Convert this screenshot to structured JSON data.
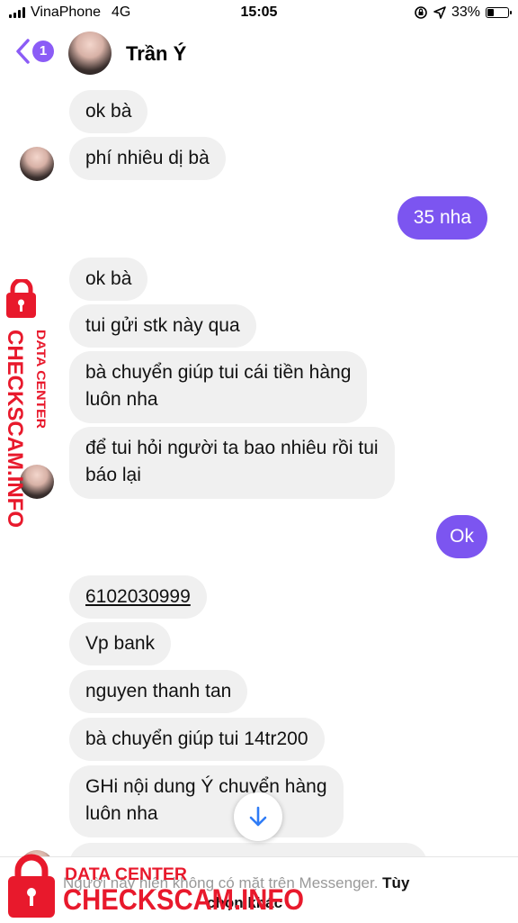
{
  "status_bar": {
    "carrier": "VinaPhone",
    "network": "4G",
    "time": "15:05",
    "battery": "33%"
  },
  "header": {
    "back_count": "1",
    "contact_name": "Trần Ý"
  },
  "messages": [
    {
      "text": "ok bà",
      "direction": "in"
    },
    {
      "text": "phí nhiêu dị bà",
      "direction": "in"
    },
    {
      "text": "35 nha",
      "direction": "out"
    },
    {
      "text": "ok bà",
      "direction": "in"
    },
    {
      "text": "tui gửi stk này qua",
      "direction": "in"
    },
    {
      "line1": "bà chuyển giúp tui cái tiền hàng",
      "line2": "luôn nha",
      "direction": "in"
    },
    {
      "line1": "để tui hỏi người ta bao nhiêu rồi tui",
      "line2": "báo lại",
      "direction": "in"
    },
    {
      "text": "Ok",
      "direction": "out"
    },
    {
      "text": "6102030999",
      "direction": "in"
    },
    {
      "text": "Vp bank",
      "direction": "in"
    },
    {
      "text": "nguyen thanh tan",
      "direction": "in"
    },
    {
      "text": "bà chuyển giúp tui 14tr200",
      "direction": "in"
    },
    {
      "line1": "GHi nội dung Ý chuyển hàng",
      "line2": "luôn nha",
      "direction": "in"
    }
  ],
  "footer": {
    "notice": "Người này hiện không có mặt trên Messenger.",
    "options_part1": "Tùy",
    "options_part2": "chọn khác"
  },
  "watermark": {
    "line1": "DATA CENTER",
    "line2": "CHECKSCAM.INFO"
  },
  "icons": {
    "back": "chevron-left-icon",
    "scroll": "arrow-down-icon",
    "lock": "lock-icon"
  },
  "colors": {
    "accent": "#7c55f0",
    "bubble_in": "#f0f0f0",
    "watermark": "#e8192c"
  }
}
